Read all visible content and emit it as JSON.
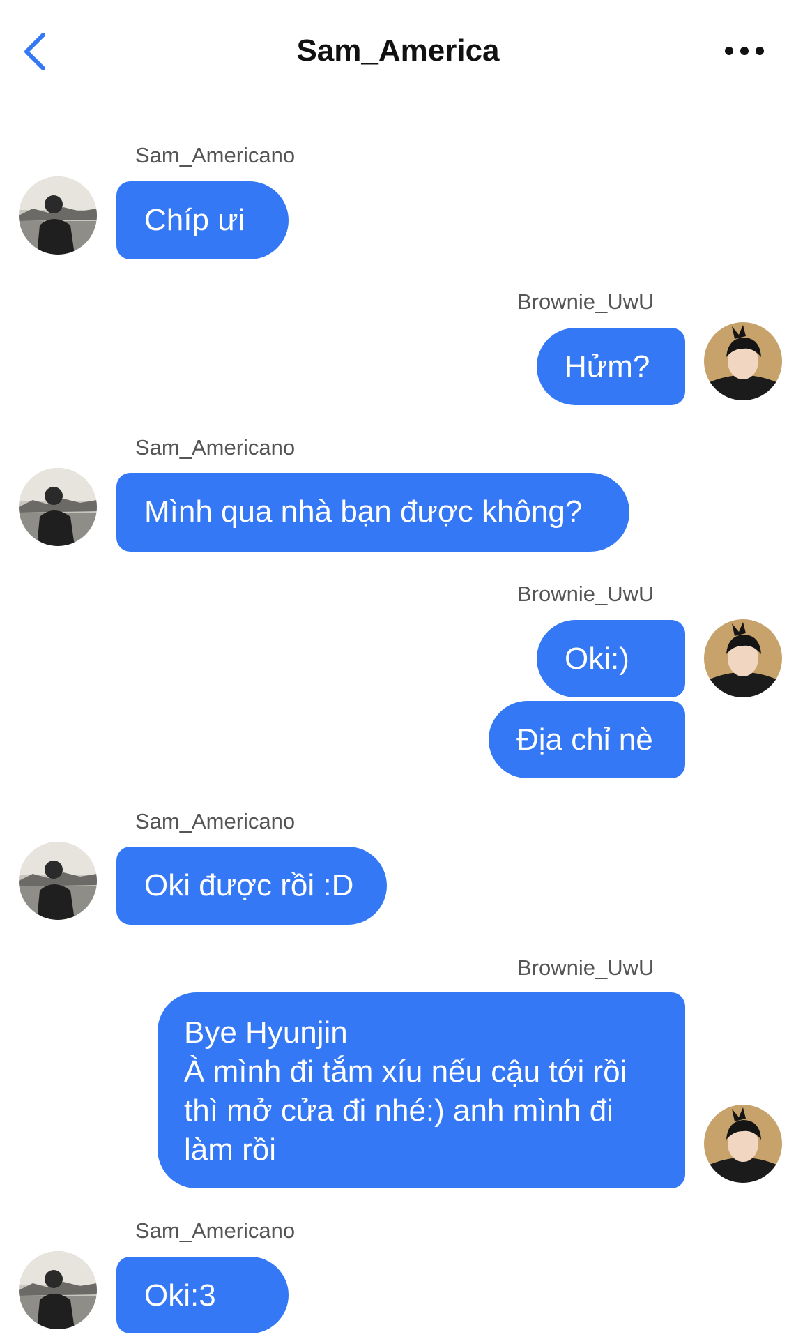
{
  "header": {
    "title": "Sam_America",
    "back_icon": "chevron-left-icon",
    "more_icon": "more-horizontal-icon"
  },
  "colors": {
    "accent": "#3478f6",
    "bubble": "#3478f6",
    "bubble_text": "#ffffff"
  },
  "messages": [
    {
      "sender": "Sam_Americano",
      "side": "left",
      "text": "Chíp ưi"
    },
    {
      "sender": "Brownie_UwU",
      "side": "right",
      "text": "Hửm?"
    },
    {
      "sender": "Sam_Americano",
      "side": "left",
      "text": "Mình qua nhà bạn được không?"
    },
    {
      "sender": "Brownie_UwU",
      "side": "right",
      "texts": [
        "Oki:)",
        "Địa chỉ nè"
      ]
    },
    {
      "sender": "Sam_Americano",
      "side": "left",
      "text": "Oki được rồi :D"
    },
    {
      "sender": "Brownie_UwU",
      "side": "right",
      "text": "Bye Hyunjin\nÀ mình đi tắm xíu nếu cậu tới rồi thì mở cửa đi nhé:) anh mình đi làm rồi"
    },
    {
      "sender": "Sam_Americano",
      "side": "left",
      "text": "Oki:3"
    }
  ]
}
